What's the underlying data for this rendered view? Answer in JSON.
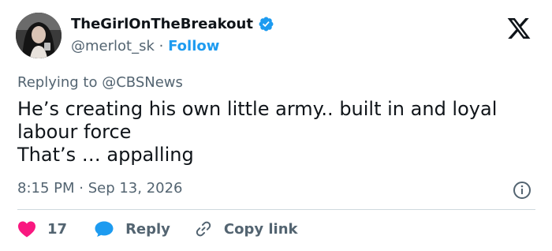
{
  "author": {
    "display_name": "TheGirlOnTheBreakout",
    "handle": "@merlot_sk",
    "separator": "·",
    "follow_label": "Follow",
    "verified": true
  },
  "brand": {
    "logo_icon": "x-logo-icon"
  },
  "reply_context": {
    "prefix": "Replying to",
    "mention": "@CBSNews"
  },
  "tweet": {
    "lines": [
      "He’s creating his own little army.. built in and loyal",
      "labour force",
      "That’s … appalling"
    ],
    "timestamp": "8:15 PM · Sep 13, 2026"
  },
  "actions": {
    "like_count": "17",
    "reply_label": "Reply",
    "copy_label": "Copy link"
  },
  "colors": {
    "like": "#f91880",
    "reply": "#1d9bf0",
    "link": "#1d9bf0",
    "muted": "#536471",
    "text": "#0f1419"
  }
}
